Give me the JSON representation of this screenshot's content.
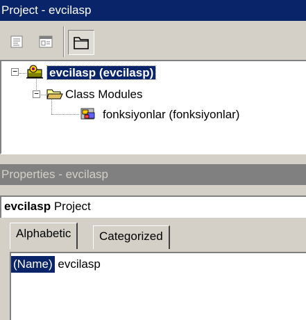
{
  "project_window": {
    "title": "Project - evcilasp",
    "toolbar": {
      "buttons": [
        {
          "name": "view-code-button",
          "icon": "view-code-icon",
          "pressed": false
        },
        {
          "name": "view-object-button",
          "icon": "view-object-icon",
          "pressed": false
        },
        {
          "name": "toggle-folders-button",
          "icon": "folder-icon",
          "pressed": true
        }
      ]
    },
    "tree": {
      "root_label": "evcilasp (evcilasp)",
      "folder_label": "Class Modules",
      "module_label": "fonksiyonlar (fonksiyonlar)",
      "root_expander": "−",
      "folder_expander": "−"
    }
  },
  "properties_window": {
    "title": "Properties - evcilasp",
    "object_name": "evcilasp",
    "object_type": "Project",
    "tabs": [
      {
        "label": "Alphabetic",
        "active": true
      },
      {
        "label": "Categorized",
        "active": false
      }
    ],
    "rows": [
      {
        "property": "(Name)",
        "value": "evcilasp"
      }
    ]
  },
  "colors": {
    "active_title": "#0a246a",
    "inactive_title": "#808080",
    "face": "#d4d0c8",
    "selection": "#0a246a"
  }
}
